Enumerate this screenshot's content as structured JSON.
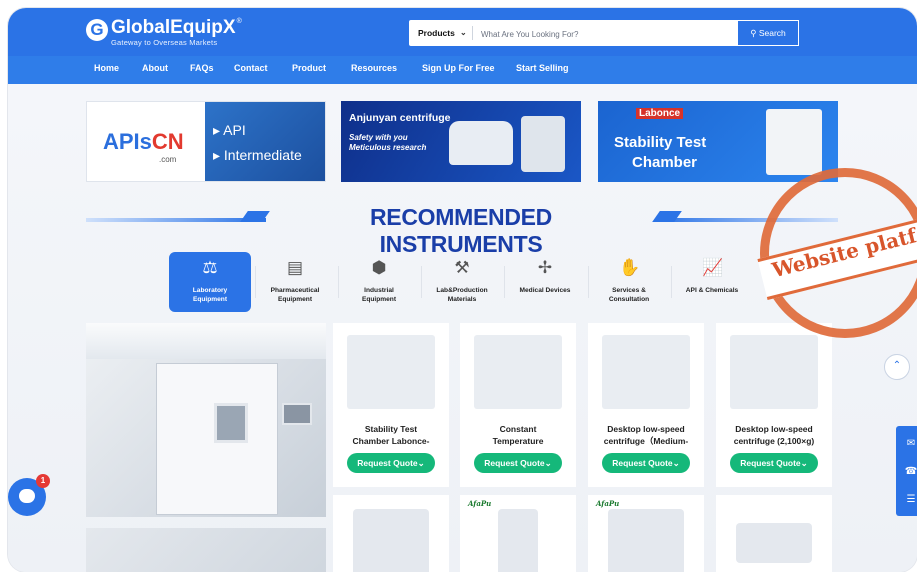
{
  "header": {
    "logo_name": "GlobalEquipX",
    "logo_trademark": "®",
    "logo_tagline": "Gateway to Overseas Markets",
    "search_category": "Products",
    "search_placeholder": "What Are You Looking For?",
    "search_button": "Search"
  },
  "nav": [
    "Home",
    "About",
    "FAQs",
    "Contact",
    "Product",
    "Resources",
    "Sign Up For Free",
    "Start Selling"
  ],
  "banners": {
    "apiscn": {
      "logo_a": "APIs",
      "logo_b": "CN",
      "logo_com": ".com",
      "line1": "API",
      "line2": "Intermediate"
    },
    "anjunyan": {
      "title": "Anjunyan centrifuge",
      "sub1": "Safety with you",
      "sub2": "Meticulous research"
    },
    "labonce": {
      "brand": "Labonce",
      "title1": "Stability Test",
      "title2": "Chamber"
    }
  },
  "section_title": "RECOMMENDED INSTRUMENTS",
  "categories": [
    {
      "line1": "Laboratory",
      "line2": "Equipment",
      "icon": "microscope-icon",
      "active": true
    },
    {
      "line1": "Pharmaceutical",
      "line2": "Equipment",
      "icon": "cabinet-icon",
      "active": false
    },
    {
      "line1": "Industrial",
      "line2": "Equipment",
      "icon": "cube-icon",
      "active": false
    },
    {
      "line1": "Lab&Production",
      "line2": "Materials",
      "icon": "tools-icon",
      "active": false
    },
    {
      "line1": "Medical Devices",
      "line2": "",
      "icon": "syringe-icon",
      "active": false
    },
    {
      "line1": "Services &",
      "line2": "Consultation",
      "icon": "hand-icon",
      "active": false
    },
    {
      "line1": "API & Chemicals",
      "line2": "",
      "icon": "chart-icon",
      "active": false
    }
  ],
  "stamp_text": "Website platf",
  "products": [
    {
      "line1": "Stability Test",
      "line2": "Chamber Labonce-",
      "quote": "Request Quote"
    },
    {
      "line1": "Constant",
      "line2": "Temperature",
      "quote": "Request Quote"
    },
    {
      "line1": "Desktop low-speed",
      "line2": "centrifuge（Medium-",
      "quote": "Request Quote"
    },
    {
      "line1": "Desktop low-speed",
      "line2": "centrifuge (2,100×g)",
      "quote": "Request Quote"
    }
  ],
  "products_row2_brand": "AfaPu",
  "chat_badge": "1",
  "colors": {
    "primary": "#2b73e6",
    "title": "#1a3ea8",
    "quote": "#15b87a",
    "stamp": "#e06a3a"
  }
}
